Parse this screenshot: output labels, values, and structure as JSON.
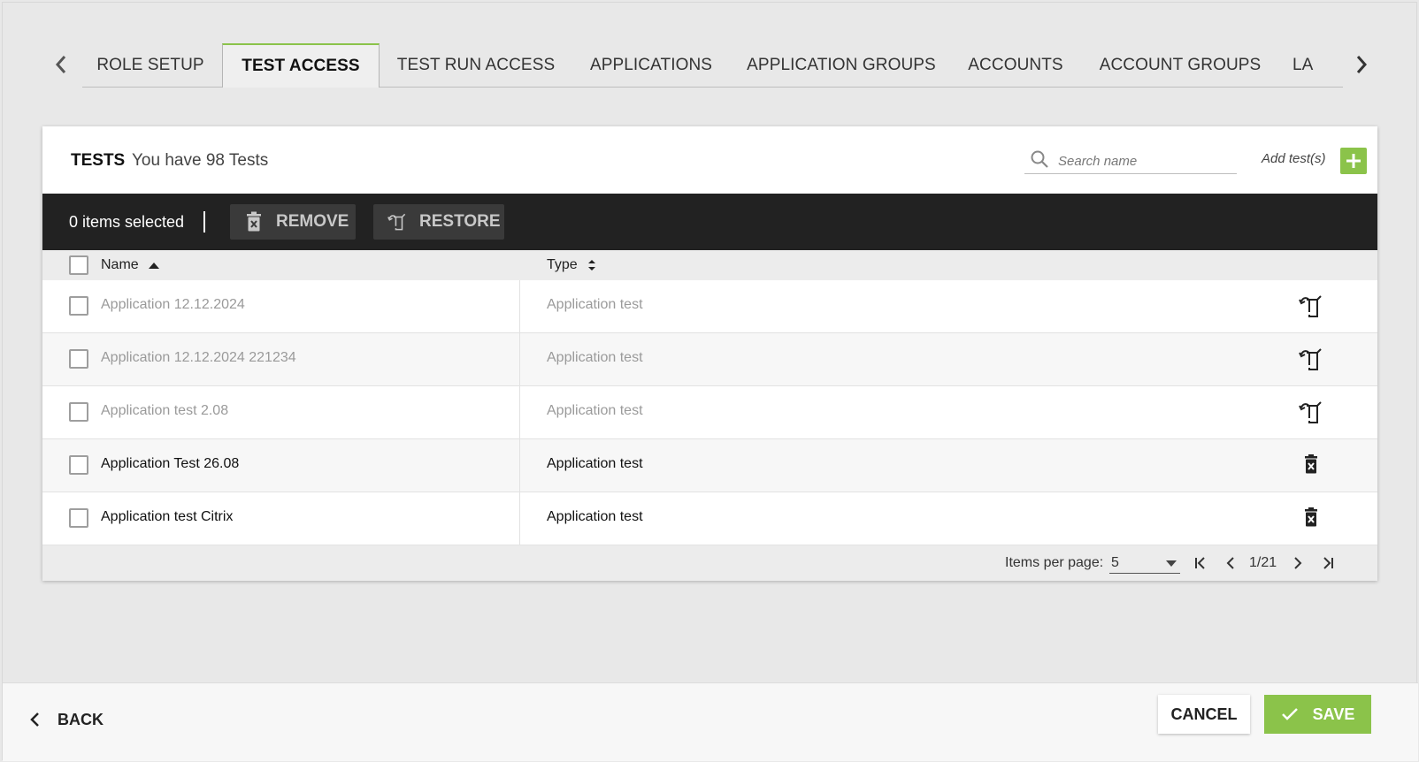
{
  "tabs": {
    "items": [
      {
        "label": "ROLE SETUP"
      },
      {
        "label": "TEST ACCESS"
      },
      {
        "label": "TEST RUN ACCESS"
      },
      {
        "label": "APPLICATIONS"
      },
      {
        "label": "APPLICATION GROUPS"
      },
      {
        "label": "ACCOUNTS"
      },
      {
        "label": "ACCOUNT GROUPS"
      },
      {
        "label": "LA"
      }
    ],
    "active_index": 1,
    "scroll_fraction": 0.8
  },
  "card": {
    "title": "TESTS",
    "subtitle": "You have 98 Tests",
    "search_placeholder": "Search name",
    "add_label": "Add test(s)"
  },
  "action_bar": {
    "selected_text": "0 items selected",
    "remove_label": "REMOVE",
    "restore_label": "RESTORE"
  },
  "table": {
    "columns": {
      "name": "Name",
      "type": "Type"
    },
    "sort": {
      "column": "name",
      "direction": "ascending"
    },
    "rows": [
      {
        "name": "Application 12.12.2024",
        "type": "Application test",
        "state": "deleted",
        "action_icon": "restore-icon"
      },
      {
        "name": "Application 12.12.2024 221234",
        "type": "Application test",
        "state": "deleted",
        "action_icon": "restore-icon"
      },
      {
        "name": "Application test 2.08",
        "type": "Application test",
        "state": "deleted",
        "action_icon": "restore-icon"
      },
      {
        "name": "Application Test 26.08",
        "type": "Application test",
        "state": "active",
        "action_icon": "delete-icon"
      },
      {
        "name": "Application test Citrix",
        "type": "Application test",
        "state": "active",
        "action_icon": "delete-icon"
      }
    ]
  },
  "pager": {
    "items_per_page_label": "Items per page:",
    "items_per_page": "5",
    "page_info": "1/21"
  },
  "footer": {
    "back_label": "BACK",
    "cancel_label": "CANCEL",
    "save_label": "SAVE"
  },
  "colors": {
    "accent": "#8bc34a",
    "action_bar": "#222222"
  }
}
